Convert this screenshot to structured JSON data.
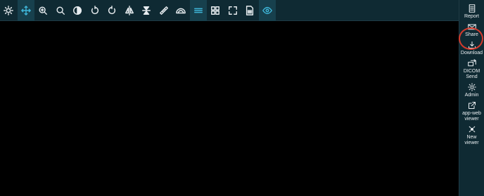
{
  "toolbar": {
    "tools": [
      {
        "name": "brightness-icon"
      },
      {
        "name": "pan-icon"
      },
      {
        "name": "zoom-in-icon"
      },
      {
        "name": "zoom-icon"
      },
      {
        "name": "invert-icon"
      },
      {
        "name": "rotate-left-icon"
      },
      {
        "name": "rotate-right-icon"
      },
      {
        "name": "flip-horizontal-icon"
      },
      {
        "name": "flip-vertical-icon"
      },
      {
        "name": "ruler-icon"
      },
      {
        "name": "angle-icon"
      },
      {
        "name": "stack-scroll-icon"
      },
      {
        "name": "layout-icon"
      },
      {
        "name": "fullscreen-icon"
      },
      {
        "name": "file-icon"
      },
      {
        "name": "eye-icon"
      }
    ],
    "active_color": "#3fb6d9"
  },
  "sidebar": {
    "items": [
      {
        "label": "Report",
        "icon": "report-icon"
      },
      {
        "label": "Share",
        "icon": "share-icon"
      },
      {
        "label": "Download",
        "icon": "download-icon"
      },
      {
        "label": "DICOM\nSend",
        "icon": "dicom-send-icon"
      },
      {
        "label": "Admin",
        "icon": "gear-icon"
      },
      {
        "label": "app-web\nviewer",
        "icon": "external-link-icon"
      },
      {
        "label": "New\nviewer",
        "icon": "new-viewer-icon"
      }
    ]
  },
  "highlight_color": "#d33a2c"
}
